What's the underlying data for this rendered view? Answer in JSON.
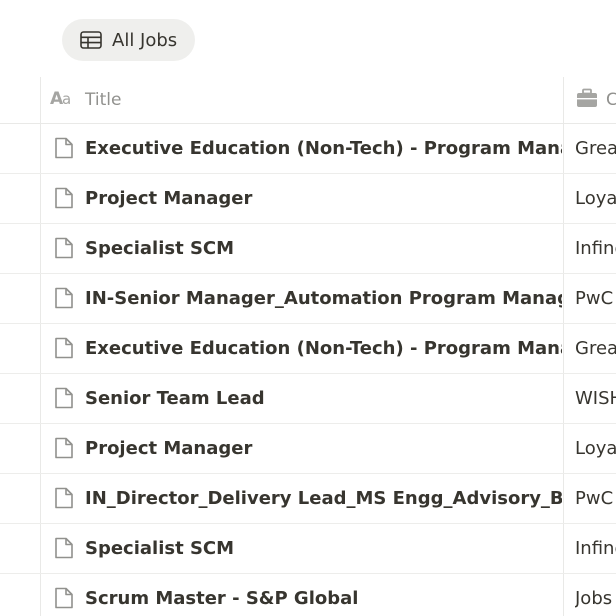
{
  "view_tab": {
    "label": "All Jobs",
    "icon": "table-icon"
  },
  "columns": {
    "title": {
      "label": "Title",
      "icon": "text-property-icon"
    },
    "company": {
      "label": "C",
      "icon": "briefcase-icon"
    }
  },
  "rows": [
    {
      "title": "Executive Education (Non-Tech) - Program Manager (Onsite)",
      "company": "Great",
      "icon": "page-icon"
    },
    {
      "title": "Project Manager",
      "company": "Loyal",
      "icon": "page-icon"
    },
    {
      "title": "Specialist SCM",
      "company": "Infine",
      "icon": "page-icon"
    },
    {
      "title": "IN-Senior Manager_Automation Program Manager_Intelligent",
      "company": "PwC",
      "icon": "page-icon"
    },
    {
      "title": "Executive Education (Non-Tech) - Program Manager (Onsite)",
      "company": "Great",
      "icon": "page-icon"
    },
    {
      "title": "Senior Team Lead",
      "company": "WISH",
      "icon": "page-icon"
    },
    {
      "title": "Project Manager",
      "company": "Loyal",
      "icon": "page-icon"
    },
    {
      "title": "IN_Director_Delivery Lead_MS Engg_Advisory_Bangalore",
      "company": "PwC",
      "icon": "page-icon"
    },
    {
      "title": "Specialist SCM",
      "company": "Infine",
      "icon": "page-icon"
    },
    {
      "title": "Scrum Master - S&P Global",
      "company": "Jobs",
      "icon": "page-icon"
    }
  ]
}
